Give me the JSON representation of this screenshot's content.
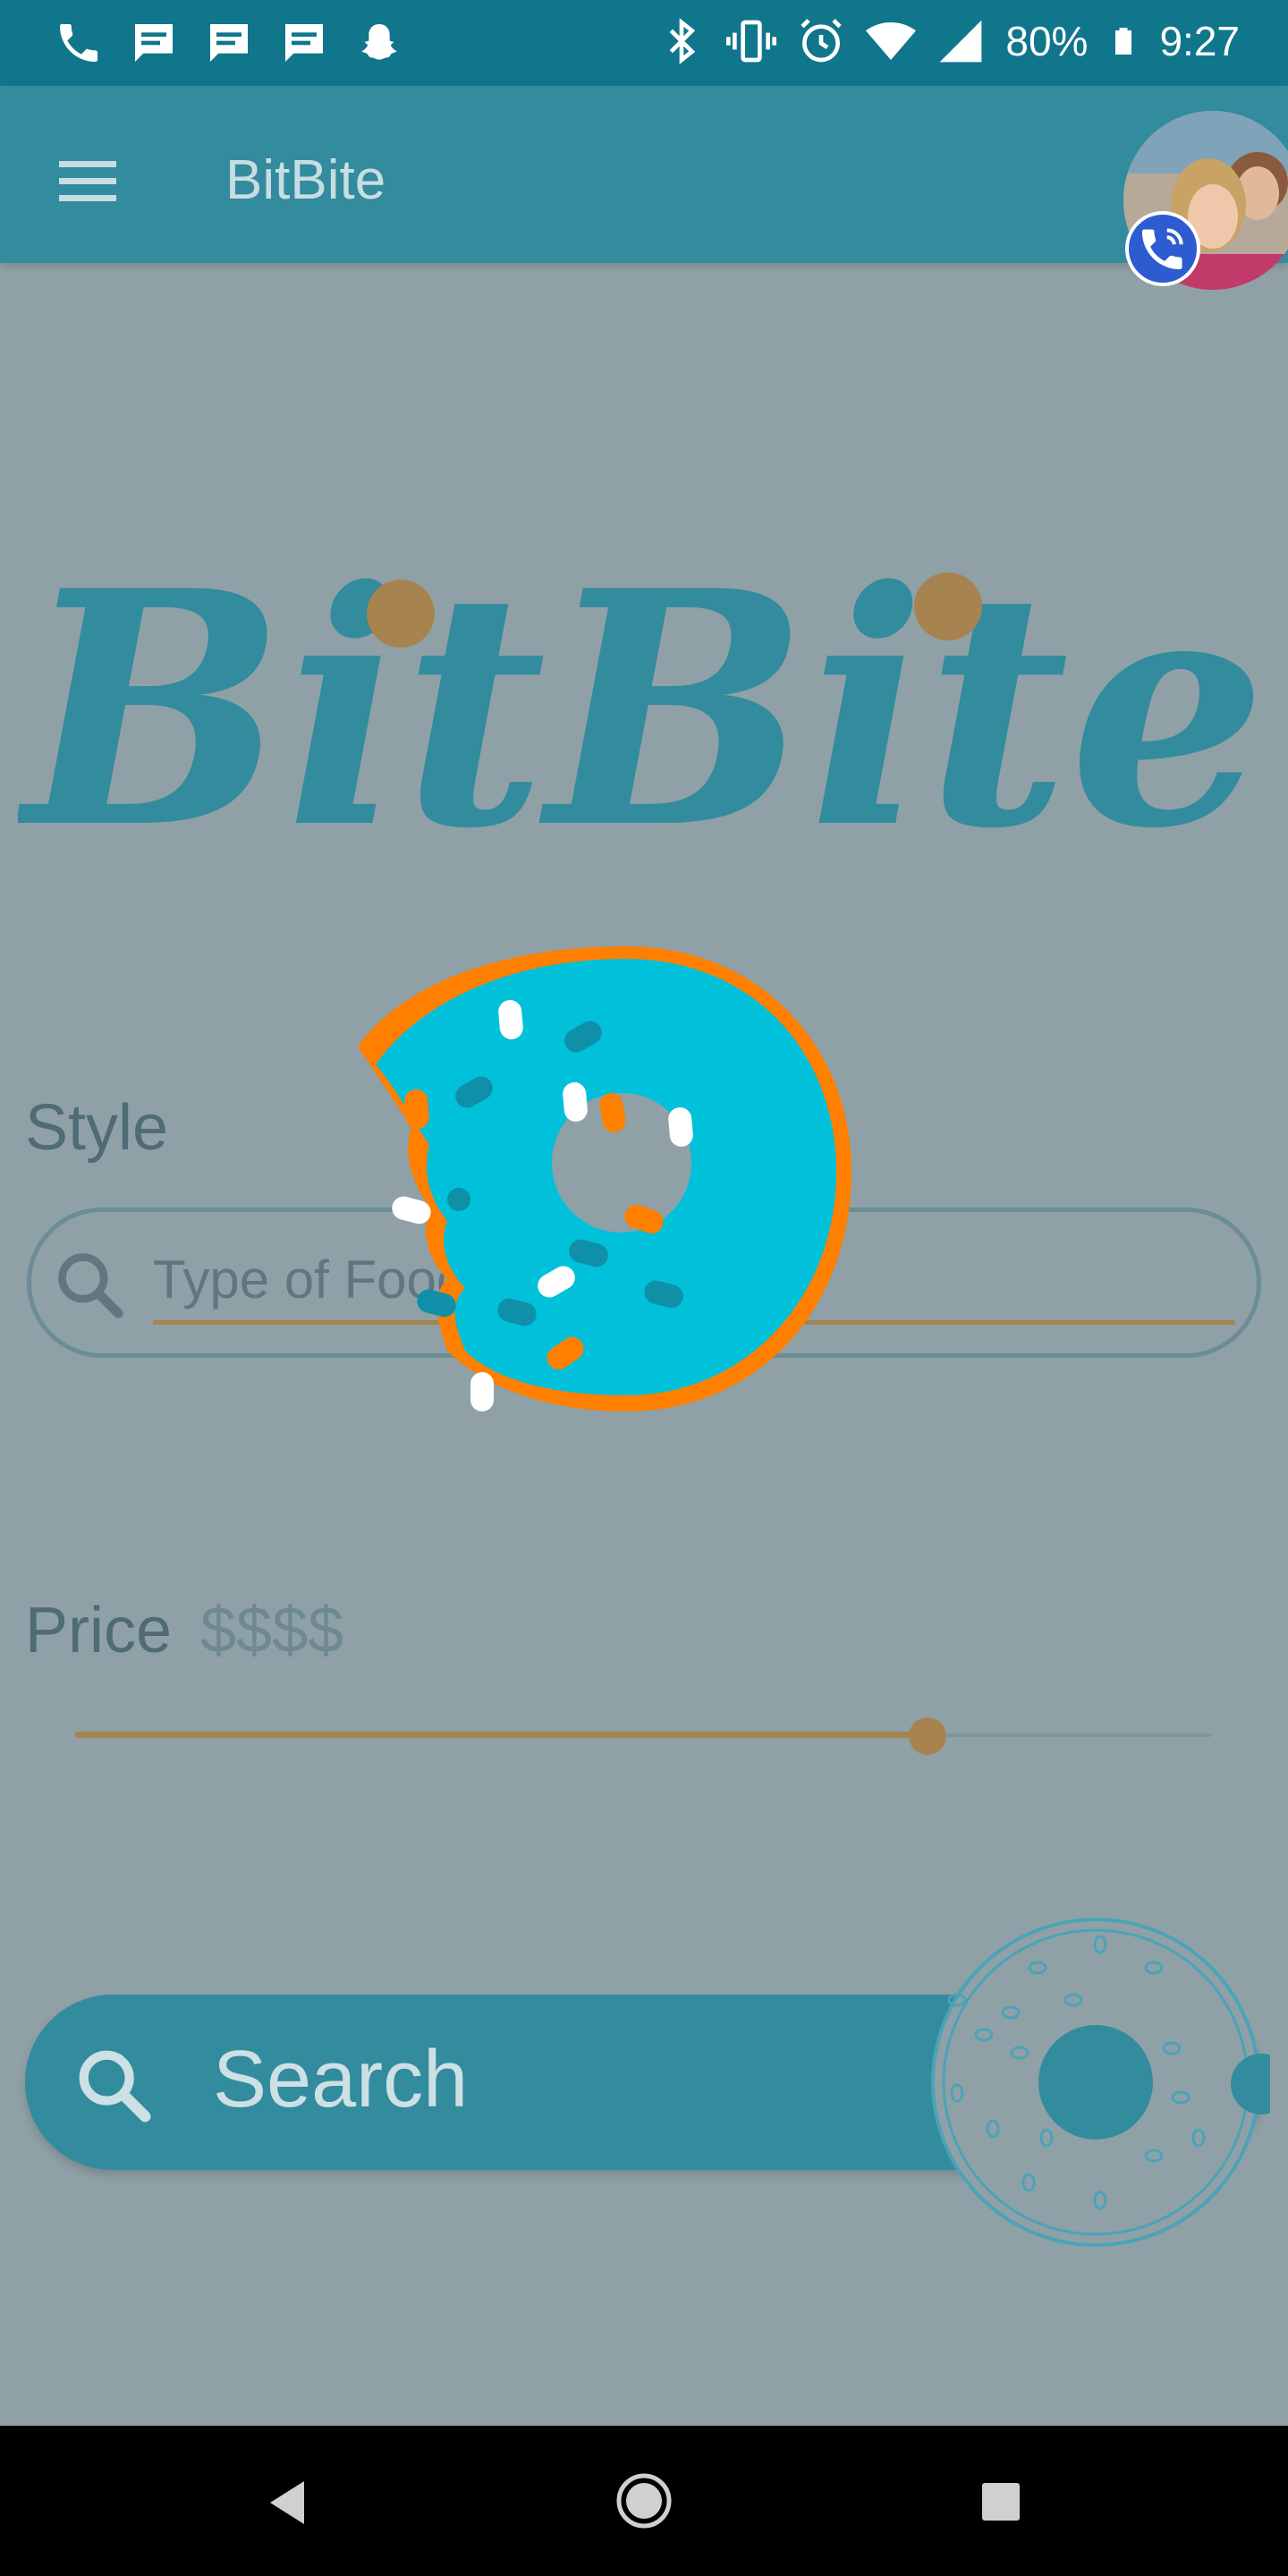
{
  "status_bar": {
    "left_icons": [
      "phone-icon",
      "message-icon",
      "message-icon",
      "message-icon",
      "snapchat-icon"
    ],
    "right_icons": [
      "bluetooth-icon",
      "vibrate-icon",
      "alarm-icon",
      "wifi-icon",
      "signal-icon",
      "battery-icon"
    ],
    "battery": "80%",
    "time": "9:27"
  },
  "app_bar": {
    "title": "BitBite",
    "menu_icon": "menu-icon"
  },
  "logo": {
    "text": "BitBite",
    "color": "#338b9e",
    "dot_color": "#a6834f"
  },
  "style_section": {
    "label": "Style",
    "input_placeholder": "Type of Food"
  },
  "price_section": {
    "label": "Price",
    "value": "$$$$",
    "slider_fraction": 0.75
  },
  "search_button": {
    "label": "Search"
  },
  "colors": {
    "primary": "#338b9e",
    "status_bar": "#10768c",
    "accent": "#a6834f",
    "donut_frosting": "#00c0da",
    "donut_dough": "#ff7f00"
  },
  "nav_bar": {
    "icons": [
      "back-icon",
      "home-icon",
      "recents-icon"
    ]
  }
}
